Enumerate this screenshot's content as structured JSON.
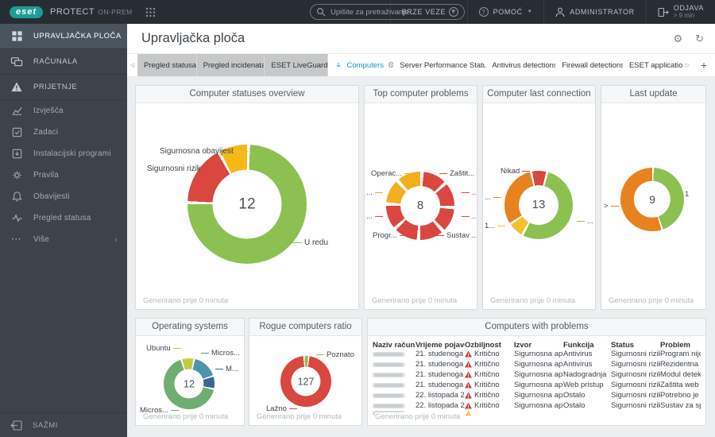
{
  "topbar": {
    "brand": "eset",
    "product": "PROTECT",
    "product_suffix": "ON-PREM",
    "search_placeholder": "Upišite za pretraživanje...",
    "quick_links": "BRZE VEZE",
    "help": "POMOĆ",
    "user": "ADMINISTRATOR",
    "logout": "ODJAVA",
    "logout_sub": "> 9 min"
  },
  "sidebar": {
    "items": [
      {
        "label": "UPRAVLJAČKA PLOČA",
        "icon": "dashboard",
        "active": true,
        "group": true
      },
      {
        "label": "RAČUNALA",
        "icon": "computers",
        "group": true
      },
      {
        "label": "PRIJETNJE",
        "icon": "threats",
        "group": true
      },
      {
        "label": "Izvješća",
        "icon": "reports"
      },
      {
        "label": "Zadaci",
        "icon": "tasks"
      },
      {
        "label": "Instalacijski programi",
        "icon": "installers"
      },
      {
        "label": "Pravila",
        "icon": "policies"
      },
      {
        "label": "Obavijesti",
        "icon": "notifications"
      },
      {
        "label": "Pregled statusa",
        "icon": "status"
      },
      {
        "label": "Više",
        "icon": "more",
        "chevron": true
      }
    ],
    "collapse": "SAŽMI"
  },
  "header": {
    "title": "Upravljačka ploča"
  },
  "tabs": [
    {
      "label": "Pregled statusa",
      "style": "gray"
    },
    {
      "label": "Pregled incidenata",
      "style": "gray"
    },
    {
      "label": "ESET LiveGuard",
      "style": "gray"
    },
    {
      "label": "Computers",
      "style": "active"
    },
    {
      "label": "Server Performance Status",
      "style": "plain"
    },
    {
      "label": "Antivirus detections",
      "style": "plain"
    },
    {
      "label": "Firewall detections",
      "style": "plain"
    },
    {
      "label": "ESET applicatio",
      "style": "plain"
    }
  ],
  "generated_note": "Generirano prije 0 minuta",
  "colors": {
    "accent": "#1E8FD0",
    "critical": "#C8433C",
    "warning": "#F2B01E",
    "brand_teal": "#1F9C95",
    "ok_green": "#8CC152"
  },
  "chart_data": [
    {
      "type": "pie",
      "title": "Computer statuses overview",
      "center": "12",
      "start_angle": 0,
      "gap_deg": 3,
      "segments": [
        {
          "label": "U redu",
          "value": 9,
          "color": "#8CC152"
        },
        {
          "label": "Sigurnosni rizik",
          "value": 2,
          "color": "#D9473F"
        },
        {
          "label": "Sigurnosna obavijest",
          "value": 1,
          "color": "#F5B916"
        }
      ]
    },
    {
      "type": "pie",
      "title": "Top computer problems",
      "center": "8",
      "start_angle": 0,
      "gap_deg": 6,
      "segments": [
        {
          "label": "Zaštit...",
          "value": 1,
          "color": "#D9473F"
        },
        {
          "label": "...",
          "value": 1,
          "color": "#D9473F"
        },
        {
          "label": "...",
          "value": 1,
          "color": "#D9473F"
        },
        {
          "label": "Sustav ...",
          "value": 1,
          "color": "#D9473F"
        },
        {
          "label": "Progr...",
          "value": 1,
          "color": "#D9473F"
        },
        {
          "label": "...",
          "value": 1,
          "color": "#D9473F"
        },
        {
          "label": "...",
          "value": 1,
          "color": "#F2B01E"
        },
        {
          "label": "Operac...",
          "value": 1,
          "color": "#F2B01E"
        }
      ]
    },
    {
      "type": "pie",
      "title": "Computer last connection",
      "center": "13",
      "start_angle": -15,
      "gap_deg": 4,
      "segments": [
        {
          "label": "Nikad",
          "value": 1,
          "color": "#D9473F"
        },
        {
          "label": "...",
          "value": 7,
          "color": "#8CC152"
        },
        {
          "label": "1...",
          "value": 1,
          "color": "#F2C12E"
        },
        {
          "label": "...",
          "value": 4,
          "color": "#E8821F"
        }
      ]
    },
    {
      "type": "pie",
      "title": "Last update",
      "center": "9",
      "start_angle": 0,
      "gap_deg": 3,
      "segments": [
        {
          "label": "1",
          "value": 4,
          "color": "#8CC152"
        },
        {
          "label": ">",
          "value": 5,
          "color": "#E8821F"
        }
      ]
    },
    {
      "type": "pie",
      "title": "Operating systems",
      "center": "12",
      "start_angle": 10,
      "gap_deg": 4,
      "segments": [
        {
          "label": "Micros...",
          "value": 2,
          "color": "#4E93AE"
        },
        {
          "label": "M...",
          "value": 1,
          "color": "#3C6791"
        },
        {
          "label": "Micros...",
          "value": 8,
          "color": "#6FAD72"
        },
        {
          "label": "Ubuntu",
          "value": 1,
          "color": "#C3CC41"
        }
      ]
    },
    {
      "type": "pie",
      "title": "Rogue computers ratio",
      "center": "127",
      "start_angle": -6,
      "gap_deg": 3,
      "segments": [
        {
          "label": "Poznato",
          "value": 4,
          "color": "#8CC152"
        },
        {
          "label": "Lažno",
          "value": 123,
          "color": "#D9473F"
        }
      ]
    },
    {
      "type": "table",
      "title": "Computers with problems",
      "columns": [
        "Naziv računala",
        "Vrijeme pojave",
        "Ozbiljnost",
        "Izvor",
        "Funkcija",
        "Status",
        "Problem"
      ],
      "rows": [
        {
          "name_redacted": true,
          "time": "21. studenoga ...",
          "severity": "Kritično",
          "severity_level": "critical",
          "source": "Sigurnosna apli...",
          "function": "Antivirus",
          "status": "Sigurnosni rizik",
          "problem": "Program nije a..."
        },
        {
          "name_redacted": true,
          "time": "21. studenoga ...",
          "severity": "Kritično",
          "severity_level": "critical",
          "source": "Sigurnosna apli...",
          "function": "Antivirus",
          "status": "Sigurnosni rizik",
          "problem": "Rezidentna zaš..."
        },
        {
          "name_redacted": true,
          "time": "21. studenoga ...",
          "severity": "Kritično",
          "severity_level": "critical",
          "source": "Sigurnosna apli...",
          "function": "Nadogradnja",
          "status": "Sigurnosni rizik",
          "problem": "Modul detekcij..."
        },
        {
          "name_redacted": true,
          "time": "21. studenoga ...",
          "severity": "Kritično",
          "severity_level": "critical",
          "source": "Sigurnosna apli...",
          "function": "Web pristup",
          "status": "Sigurnosni rizik",
          "problem": "Zaštita web pri..."
        },
        {
          "name_redacted": true,
          "time": "22. listopada 2...",
          "severity": "Kritično",
          "severity_level": "critical",
          "source": "Sigurnosna apli...",
          "function": "Ostalo",
          "status": "Sigurnosni rizik",
          "problem": "Potrebno je po..."
        },
        {
          "name_redacted": true,
          "time": "22. listopada 2...",
          "severity": "Kritično",
          "severity_level": "critical",
          "source": "Sigurnosna apli...",
          "function": "Ostalo",
          "status": "Sigurnosni rizik",
          "problem": "Sustav za spreč..."
        },
        {
          "name_redacted": true,
          "time": "",
          "severity": "",
          "severity_level": "warning",
          "source": "",
          "function": "",
          "status": "",
          "problem": "",
          "partial": true
        }
      ]
    }
  ]
}
